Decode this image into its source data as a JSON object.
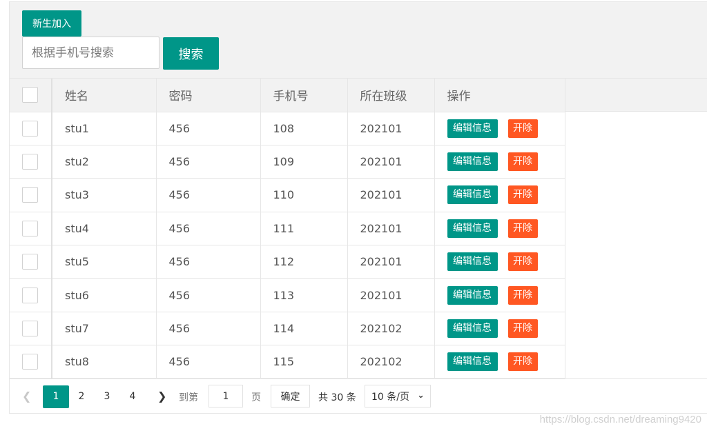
{
  "toolbar": {
    "new_button": "新生加入",
    "search_placeholder": "根据手机号搜索",
    "search_button": "搜索"
  },
  "table": {
    "headers": [
      "姓名",
      "密码",
      "手机号",
      "所在班级",
      "操作"
    ],
    "rows": [
      {
        "name": "stu1",
        "password": "456",
        "phone": "108",
        "class": "202101"
      },
      {
        "name": "stu2",
        "password": "456",
        "phone": "109",
        "class": "202101"
      },
      {
        "name": "stu3",
        "password": "456",
        "phone": "110",
        "class": "202101"
      },
      {
        "name": "stu4",
        "password": "456",
        "phone": "111",
        "class": "202101"
      },
      {
        "name": "stu5",
        "password": "456",
        "phone": "112",
        "class": "202101"
      },
      {
        "name": "stu6",
        "password": "456",
        "phone": "113",
        "class": "202101"
      },
      {
        "name": "stu7",
        "password": "456",
        "phone": "114",
        "class": "202102"
      },
      {
        "name": "stu8",
        "password": "456",
        "phone": "115",
        "class": "202102"
      }
    ],
    "edit_label": "编辑信息",
    "delete_label": "开除"
  },
  "pagination": {
    "prev_icon": "chevron-left-icon",
    "next_icon": "chevron-right-icon",
    "pages": [
      "1",
      "2",
      "3",
      "4"
    ],
    "current_page": "1",
    "goto_label": "到第",
    "goto_value": "1",
    "page_label": "页",
    "confirm_label": "确定",
    "total_label": "共 30 条",
    "page_size": "10 条/页"
  },
  "watermark": "https://blog.csdn.net/dreaming9420",
  "colors": {
    "primary": "#009688",
    "danger": "#FF5722",
    "toolbar_bg": "#f2f2f2"
  }
}
